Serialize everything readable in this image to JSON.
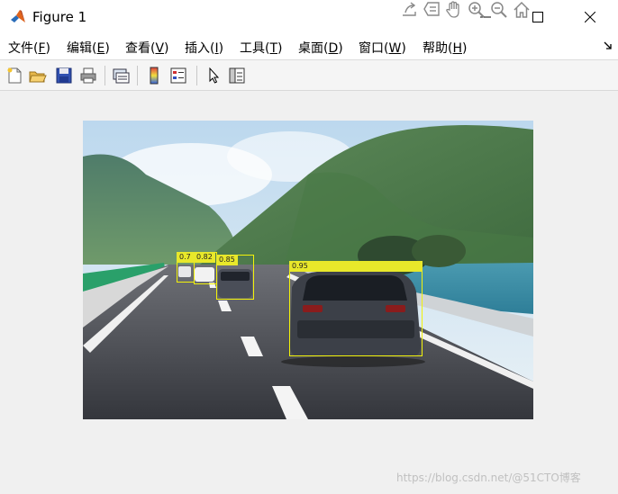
{
  "window": {
    "title": "Figure 1"
  },
  "menubar": {
    "items": [
      {
        "label": "文件(",
        "key": "F",
        "tail": ")"
      },
      {
        "label": "编辑(",
        "key": "E",
        "tail": ")"
      },
      {
        "label": "查看(",
        "key": "V",
        "tail": ")"
      },
      {
        "label": "插入(",
        "key": "I",
        "tail": ")"
      },
      {
        "label": "工具(",
        "key": "T",
        "tail": ")"
      },
      {
        "label": "桌面(",
        "key": "D",
        "tail": ")"
      },
      {
        "label": "窗口(",
        "key": "W",
        "tail": ")"
      },
      {
        "label": "帮助(",
        "key": "H",
        "tail": ")"
      }
    ]
  },
  "detections": [
    {
      "score": "0.7"
    },
    {
      "score": "0.82"
    },
    {
      "score": "0.85"
    },
    {
      "score": "0.95"
    }
  ],
  "colors": {
    "box": "#f2f20a",
    "label_bg": "#e8e82a",
    "window_bg": "#f0f0f0"
  },
  "watermark": {
    "text": "https://blog.csdn.net/@51CTO博客"
  }
}
